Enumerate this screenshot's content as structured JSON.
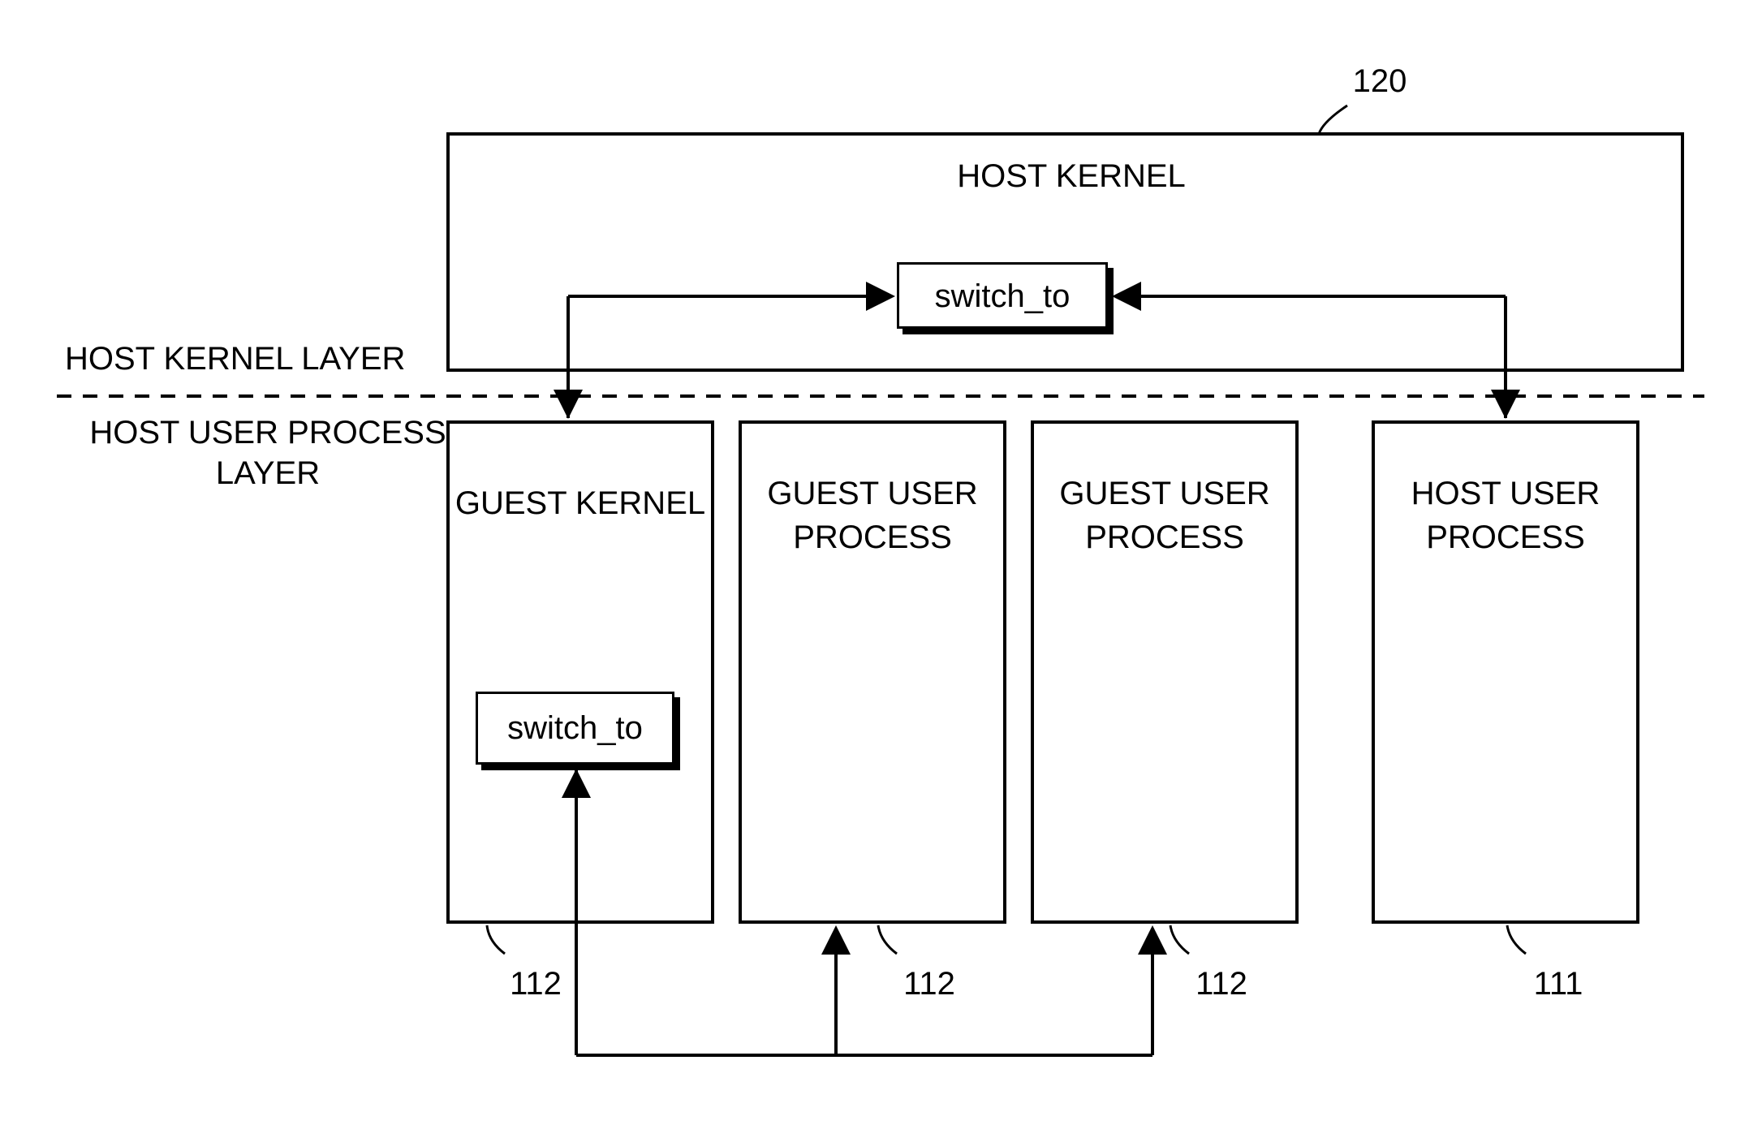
{
  "refs": {
    "top": "120",
    "box0": "112",
    "box1": "112",
    "box2": "112",
    "box3": "111"
  },
  "layers": {
    "kernel": "HOST KERNEL LAYER",
    "user": "HOST USER PROCESS\nLAYER"
  },
  "hostKernel": {
    "title": "HOST KERNEL",
    "switch": "switch_to"
  },
  "guestKernel": {
    "title": "GUEST KERNEL",
    "switch": "switch_to"
  },
  "guestUser1": "GUEST USER\nPROCESS",
  "guestUser2": "GUEST USER\nPROCESS",
  "hostUser": "HOST USER\nPROCESS"
}
